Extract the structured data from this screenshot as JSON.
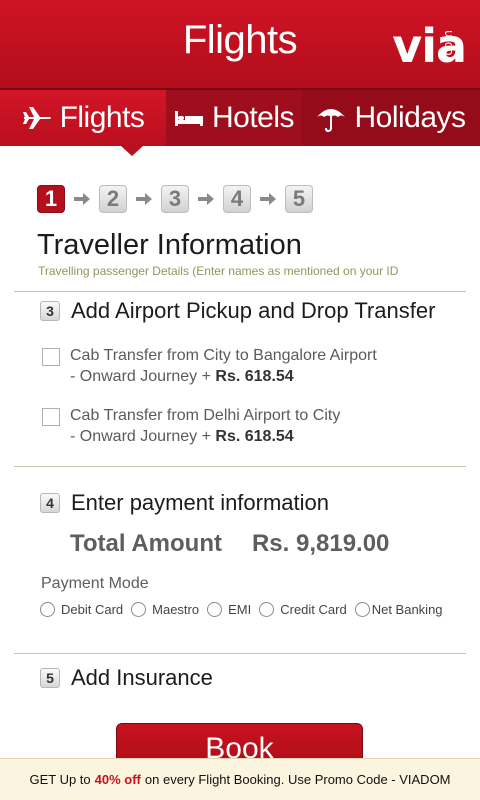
{
  "header": {
    "title": "Flights",
    "logo": "via",
    "logo_suffix": ".com"
  },
  "tabs": [
    {
      "label": "Flights",
      "icon": "airplane-icon",
      "active": true
    },
    {
      "label": "Hotels",
      "icon": "bed-icon",
      "active": false
    },
    {
      "label": "Holidays",
      "icon": "umbrella-icon",
      "active": false
    }
  ],
  "steps": [
    "1",
    "2",
    "3",
    "4",
    "5"
  ],
  "active_step": "1",
  "traveller": {
    "title": "Traveller Information",
    "subtitle": "Travelling passenger Details (Enter names as mentioned on your ID"
  },
  "transfer": {
    "number": "3",
    "title": "Add Airport Pickup and Drop Transfer",
    "options": [
      {
        "line1": "Cab Transfer from City to Bangalore Airport",
        "line2": "- Onward Journey +",
        "price": "Rs. 618.54",
        "checked": false
      },
      {
        "line1": "Cab Transfer from Delhi Airport to City",
        "line2": "- Onward Journey +",
        "price": "Rs. 618.54",
        "checked": false
      }
    ]
  },
  "payment": {
    "number": "4",
    "title": "Enter payment information",
    "total_label": "Total Amount",
    "total_value": "Rs. 9,819.00",
    "mode_label": "Payment Mode",
    "modes": [
      "Debit Card",
      "Maestro",
      "EMI",
      "Credit Card",
      "Net Banking"
    ]
  },
  "insurance": {
    "number": "5",
    "title": "Add Insurance"
  },
  "book_label": "Book",
  "promo": {
    "prefix": "GET Up to",
    "highlight": "40% off",
    "suffix": "on every Flight Booking. Use Promo Code - VIADOM"
  },
  "colors": {
    "brand_red": "#c8121f",
    "tab_dark": "#8f0c18",
    "subtitle_green": "#8a9a5b",
    "promo_bg": "#fbf4df"
  }
}
